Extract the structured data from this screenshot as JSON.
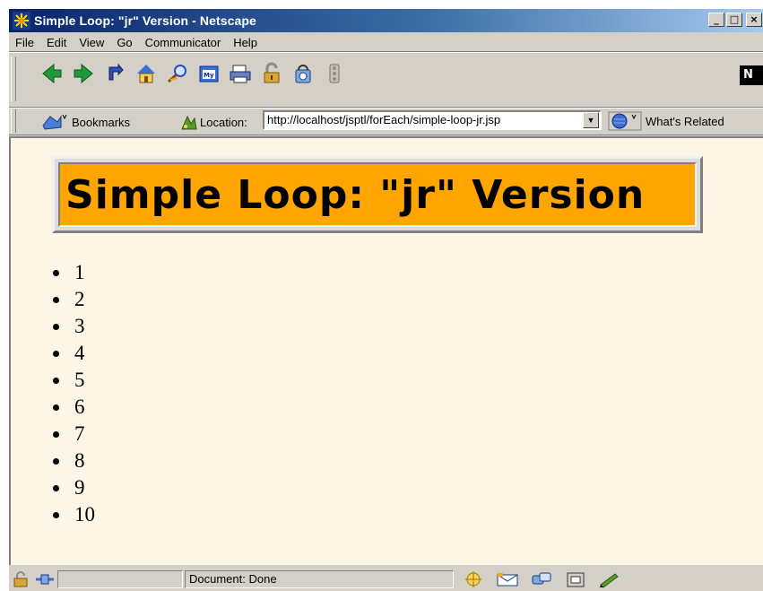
{
  "window": {
    "title": "Simple Loop: \"jr\" Version - Netscape",
    "minimize_glyph": "_",
    "maximize_glyph": "□",
    "close_glyph": "×"
  },
  "menu": [
    "File",
    "Edit",
    "View",
    "Go",
    "Communicator",
    "Help"
  ],
  "nav_toolbar": {
    "icons": [
      "back-icon",
      "forward-icon",
      "reload-icon",
      "home-icon",
      "search-icon",
      "my-netscape-icon",
      "print-icon",
      "security-icon",
      "shop-icon",
      "stop-icon"
    ],
    "logo_text": "N"
  },
  "location_bar": {
    "bookmarks_label": "Bookmarks",
    "location_label": "Location:",
    "url": "http://localhost/jsptl/forEach/simple-loop-jr.jsp",
    "whats_related_label": "What's Related"
  },
  "page": {
    "heading": "Simple Loop: \"jr\" Version",
    "heading_bg": "#ffa500",
    "page_bg": "#fdf5e6",
    "items": [
      "1",
      "2",
      "3",
      "4",
      "5",
      "6",
      "7",
      "8",
      "9",
      "10"
    ]
  },
  "status_bar": {
    "status_text": "Document: Done"
  }
}
